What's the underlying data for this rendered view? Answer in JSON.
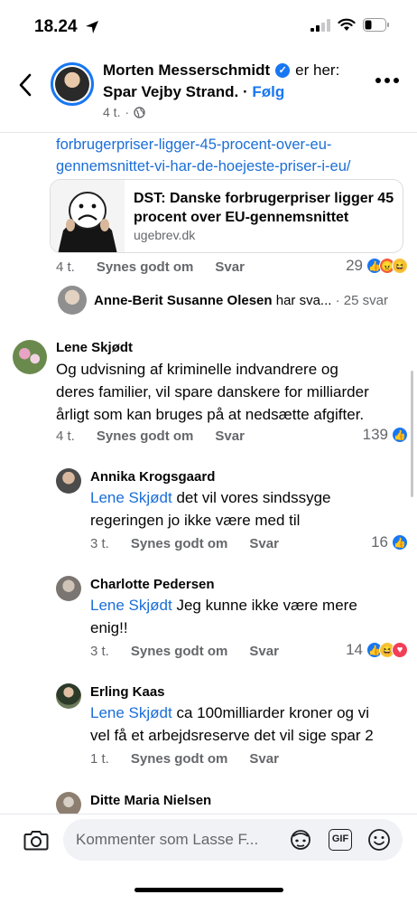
{
  "status": {
    "time": "18.24"
  },
  "header": {
    "name": "Morten Messerschmidt",
    "suffix": "er her:",
    "place": "Spar Vejby Strand.",
    "follow": "Følg",
    "age": "4 t.",
    "separator": "·",
    "icons": [
      "back-arrow-icon",
      "verified-badge-icon",
      "globe-icon",
      "more-options-icon"
    ]
  },
  "post": {
    "url_line1": "forbrugerpriser-ligger-45-procent-over-eu-",
    "url_line2": "gennemsnittet-vi-har-de-hoejeste-priser-i-eu/",
    "card": {
      "title": "DST: Danske forbrugerpriser ligger 45 procent over EU-gennemsnittet",
      "domain": "ugebrev.dk"
    },
    "time": "4 t.",
    "like_label": "Synes godt om",
    "reply_label": "Svar",
    "reaction_count": "29",
    "reactions": [
      "like",
      "angry",
      "haha"
    ]
  },
  "reply_summary": {
    "name": "Anne-Berit Susanne Olesen",
    "text": "har sva...",
    "separator": "·",
    "count": "25 svar"
  },
  "comments": [
    {
      "name": "Lene Skjødt",
      "text": "Og udvisning af kriminelle indvandrere og deres familier,  vil spare danskere for milliarder årligt som kan bruges på at nedsætte afgifter.",
      "line1": "Og udvisning af kriminelle indvandrere og",
      "line2": "deres familier,  vil spare danskere for milliarder",
      "line3": "årligt som kan bruges på at nedsætte afgifter.",
      "time": "4 t.",
      "like_label": "Synes godt om",
      "reply_label": "Svar",
      "reaction_count": "139",
      "reactions": [
        "like"
      ]
    }
  ],
  "replies": [
    {
      "name": "Annika Krogsgaard",
      "mention": "Lene Skjødt",
      "line1": "det vil vores sindssyge",
      "line2": "regeringen jo ikke være med til",
      "time": "3 t.",
      "like_label": "Synes godt om",
      "reply_label": "Svar",
      "reaction_count": "16",
      "reactions": [
        "like"
      ]
    },
    {
      "name": "Charlotte Pedersen",
      "mention": "Lene Skjødt",
      "line1": "Jeg kunne ikke være mere",
      "line2": "enig!!",
      "time": "3 t.",
      "like_label": "Synes godt om",
      "reply_label": "Svar",
      "reaction_count": "14",
      "reactions": [
        "like",
        "haha",
        "love"
      ]
    },
    {
      "name": "Erling Kaas",
      "mention": "Lene Skjødt",
      "line1": "ca 100milliarder kroner og vi",
      "line2": "vel få et arbejdsreserve det vil sige spar 2",
      "time": "1 t.",
      "like_label": "Synes godt om",
      "reply_label": "Svar"
    },
    {
      "name": "Ditte Maria Nielsen"
    }
  ],
  "composer": {
    "placeholder": "Kommenter som Lasse F...",
    "gif_label": "GIF",
    "icons": [
      "camera-icon",
      "avatar-sticker-icon",
      "gif-icon",
      "emoji-icon"
    ]
  },
  "colors": {
    "link": "#1a6ed8",
    "facebook_blue": "#1877f2",
    "meta_gray": "#65676b",
    "composer_bg": "#f0f2f5"
  }
}
